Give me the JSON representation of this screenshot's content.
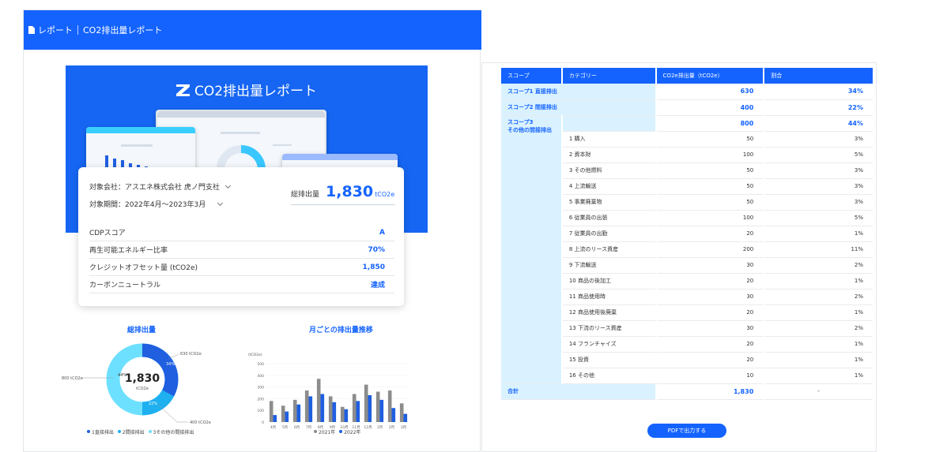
{
  "breadcrumb": {
    "root": "レポート",
    "current": "CO2排出量レポート"
  },
  "hero": {
    "title": "CO2排出量レポート"
  },
  "filters": {
    "company": "対象会社：アスエネ株式会社 虎ノ門支社",
    "period": "対象期間：2022年4月〜2023年3月"
  },
  "total": {
    "label": "総排出量",
    "value": "1,830",
    "unit": "tCO2e"
  },
  "summary_rows": [
    {
      "label": "CDPスコア",
      "value": "A"
    },
    {
      "label": "再生可能エネルギー比率",
      "value": "70%"
    },
    {
      "label": "クレジットオフセット量 (tCO2e)",
      "value": "1,850"
    },
    {
      "label": "カーボンニュートラル",
      "value": "達成"
    }
  ],
  "donut": {
    "title": "総排出量",
    "center_value": "1,830",
    "center_unit": "tCO2e",
    "label_630": "630 tCO2e",
    "label_400": "400 tCO2e",
    "label_800": "800 tCO2e",
    "pct_34": "34%",
    "pct_22": "22%",
    "pct_44": "44%",
    "legend": [
      "1直接排出",
      "2間接排出",
      "3その他の間接排出"
    ],
    "colors": [
      "#1f5fe0",
      "#1fb0f0",
      "#6ee0ff"
    ]
  },
  "chart_data": {
    "type": "bar",
    "title": "月ごとの排出量推移",
    "ylabel": "(tCO2e)",
    "ylim": [
      0,
      500
    ],
    "yticks": [
      "0",
      "100",
      "200",
      "300",
      "400",
      "500"
    ],
    "categories": [
      "4月",
      "5月",
      "6月",
      "7月",
      "8月",
      "9月",
      "10月",
      "11月",
      "12月",
      "1月",
      "2月",
      "3月"
    ],
    "series": [
      {
        "name": "2021年",
        "color": "#8c8c8c",
        "values": [
          180,
          140,
          190,
          270,
          370,
          220,
          130,
          240,
          320,
          260,
          270,
          160
        ]
      },
      {
        "name": "2022年",
        "color": "#1f5fe0",
        "values": [
          60,
          90,
          150,
          220,
          240,
          170,
          110,
          180,
          230,
          190,
          120,
          70
        ]
      }
    ]
  },
  "table": {
    "headers": [
      "スコープ",
      "カテゴリー",
      "CO2e排出量（tCO2e）",
      "割合"
    ],
    "scope1": {
      "label": "スコープ1 直接排出",
      "value": "630",
      "pct": "34%"
    },
    "scope2": {
      "label": "スコープ2 間接排出",
      "value": "400",
      "pct": "22%"
    },
    "scope3": {
      "label": "スコープ3",
      "sublabel": "その他の間接排出",
      "value": "800",
      "pct": "44%"
    },
    "categories": [
      {
        "name": "1 購入",
        "value": "50",
        "pct": "3%"
      },
      {
        "name": "2 資本財",
        "value": "100",
        "pct": "5%"
      },
      {
        "name": "3 その他燃料",
        "value": "50",
        "pct": "3%"
      },
      {
        "name": "4 上流輸送",
        "value": "50",
        "pct": "3%"
      },
      {
        "name": "5 事業廃棄物",
        "value": "50",
        "pct": "3%"
      },
      {
        "name": "6 従業員の出張",
        "value": "100",
        "pct": "5%"
      },
      {
        "name": "7 従業員の出勤",
        "value": "20",
        "pct": "1%"
      },
      {
        "name": "8 上流のリース資産",
        "value": "200",
        "pct": "11%"
      },
      {
        "name": "9 下流輸送",
        "value": "30",
        "pct": "2%"
      },
      {
        "name": "10 商品の後加工",
        "value": "20",
        "pct": "1%"
      },
      {
        "name": "11 商品使用時",
        "value": "30",
        "pct": "2%"
      },
      {
        "name": "12 商品使用後廃棄",
        "value": "20",
        "pct": "1%"
      },
      {
        "name": "13 下流のリース資産",
        "value": "30",
        "pct": "2%"
      },
      {
        "name": "14 フランチャイズ",
        "value": "20",
        "pct": "1%"
      },
      {
        "name": "15 投資",
        "value": "20",
        "pct": "1%"
      },
      {
        "name": "16 その他",
        "value": "10",
        "pct": "1%"
      }
    ],
    "total": {
      "label": "合計",
      "value": "1,830",
      "pct": "-"
    }
  },
  "pdf_button": "PDFで出力する"
}
